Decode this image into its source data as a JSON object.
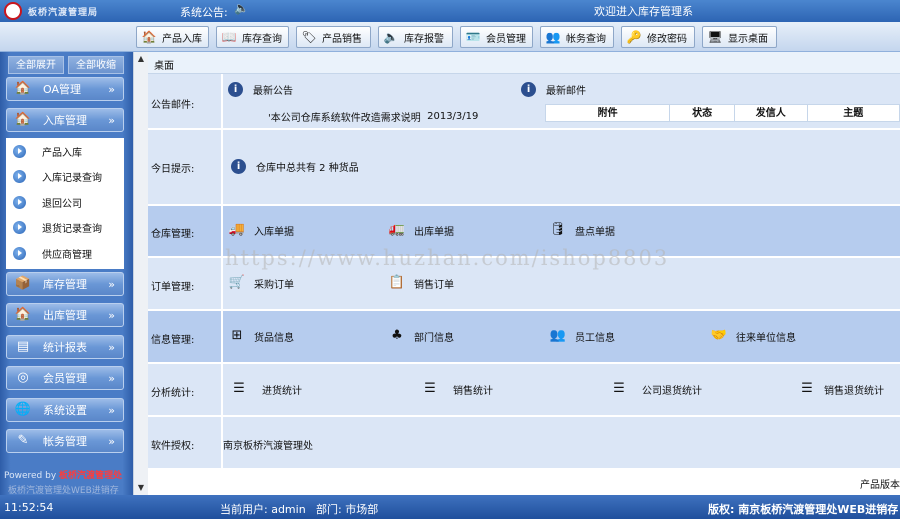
{
  "header": {
    "logo_text": "板桥汽渡管理局",
    "notice_label": "系统公告:",
    "welcome": "欢迎进入库存管理系"
  },
  "toolbar": [
    {
      "label": "产品入库",
      "icon": "house-arrow-icon"
    },
    {
      "label": "库存查询",
      "icon": "book-icon"
    },
    {
      "label": "产品销售",
      "icon": "tag-icon"
    },
    {
      "label": "库存报警",
      "icon": "speaker-icon"
    },
    {
      "label": "会员管理",
      "icon": "id-card-icon"
    },
    {
      "label": "帐务查询",
      "icon": "people-icon"
    },
    {
      "label": "修改密码",
      "icon": "key-icon"
    },
    {
      "label": "显示桌面",
      "icon": "desktop-icon"
    }
  ],
  "sidebar": {
    "expand_all": "全部展开",
    "collapse_all": "全部收缩",
    "groups": [
      "OA管理",
      "入库管理",
      "库存管理",
      "出库管理",
      "统计报表",
      "会员管理",
      "系统设置",
      "帐务管理"
    ],
    "sub_items": [
      "产品入库",
      "入库记录查询",
      "退回公司",
      "退货记录查询",
      "供应商管理"
    ],
    "powered_prefix": "Powered by",
    "powered_name": "板桥汽渡管理处",
    "powered_sub": "板桥汽渡管理处WEB进销存"
  },
  "main": {
    "breadcrumb": "桌面",
    "rows": {
      "announce": {
        "label": "公告邮件:",
        "notice_title": "最新公告",
        "notice_item": "'本公司仓库系统软件改造需求说明",
        "notice_date": "2013/3/19",
        "mail_title": "最新邮件",
        "mail_cols": [
          "附件",
          "状态",
          "发信人",
          "主题"
        ]
      },
      "today": {
        "label": "今日提示:",
        "text": "仓库中总共有  2  种货品"
      },
      "warehouse": {
        "label": "仓库管理:",
        "items": [
          "入库单据",
          "出库单据",
          "盘点单据"
        ]
      },
      "orders": {
        "label": "订单管理:",
        "items": [
          "采购订单",
          "销售订单"
        ]
      },
      "info": {
        "label": "信息管理:",
        "items": [
          "货品信息",
          "部门信息",
          "员工信息",
          "往来单位信息"
        ]
      },
      "analysis": {
        "label": "分析统计:",
        "items": [
          "进货统计",
          "销售统计",
          "公司退货统计",
          "销售退货统计"
        ]
      },
      "license": {
        "label": "软件授权:",
        "text": "南京板桥汽渡管理处"
      }
    },
    "bottom_label": "产品版本",
    "watermark": "https://www.huzhan.com/ishop8803"
  },
  "status": {
    "time": "11:52:54",
    "user_label": "当前用户: admin",
    "dept_label": "部门: 市场部",
    "copyright": "版权: 南京板桥汽渡管理处WEB进销存"
  }
}
